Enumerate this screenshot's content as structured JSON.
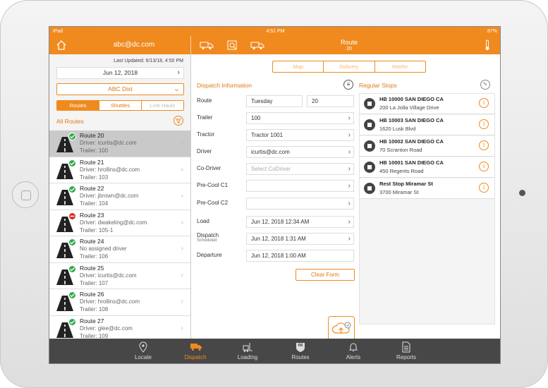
{
  "status": {
    "device": "iPad",
    "time": "4:51 PM",
    "battery": "87%"
  },
  "header": {
    "user_email": "abc@dc.com",
    "title": "Route",
    "route_number": "20"
  },
  "sidebar": {
    "last_updated": "Last Updated: 6/13/18, 4:50 PM",
    "date": "Jun 12, 2018",
    "distribution": "ABC Dist",
    "tabs": [
      "Routes",
      "Shuttles",
      "Line Hauls"
    ],
    "list_title": "All Routes",
    "routes": [
      {
        "name": "Route 20",
        "line1": "Driver: icurtis@dc.com",
        "line2": "Trailer: 100",
        "status": "ok"
      },
      {
        "name": "Route 21",
        "line1": "Driver: hrollins@dc.com",
        "line2": "Trailer: 103",
        "status": "ok"
      },
      {
        "name": "Route 22",
        "line1": "Driver: jbrown@dc.com",
        "line2": "Trailer: 104",
        "status": "ok"
      },
      {
        "name": "Route 23",
        "line1": "Driver: dwakeling@dc.com",
        "line2": "Trailer: 105-1",
        "status": "error"
      },
      {
        "name": "Route 24",
        "line1": "No assigned driver",
        "line2": "Trailer: 106",
        "status": "ok"
      },
      {
        "name": "Route 25",
        "line1": "Driver: icurtis@dc.com",
        "line2": "Trailer: 107",
        "status": "ok"
      },
      {
        "name": "Route 26",
        "line1": "Driver: hrollins@dc.com",
        "line2": "Trailer: 108",
        "status": "ok"
      },
      {
        "name": "Route 27",
        "line1": "Driver: glee@dc.com",
        "line2": "Trailer: 109",
        "status": "ok"
      }
    ]
  },
  "main": {
    "view_tabs": [
      "Map",
      "Delivery",
      "Reefer"
    ],
    "dispatch_title": "Dispatch Information",
    "stops_title": "Regular Stops",
    "fields": {
      "route_label": "Route",
      "route_day": "Tuesday",
      "route_number": "20",
      "trailer_label": "Trailer",
      "trailer": "100",
      "tractor_label": "Tractor",
      "tractor": "Tractor 1001",
      "driver_label": "Driver",
      "driver": "icurtis@dc.com",
      "codriver_label": "Co-Driver",
      "codriver_placeholder": "Select CoDriver",
      "precool1_label": "Pre-Cool C1",
      "precool1": "",
      "precool2_label": "Pre-Cool C2",
      "precool2": "",
      "load_label": "Load",
      "load": "Jun 12, 2018 12:34 AM",
      "dispatch_label": "Dispatch",
      "dispatch_sub": "Scheduled",
      "dispatch": "Jun 12, 2018 1:31 AM",
      "departure_label": "Departure",
      "departure": "Jun 12, 2018 1:00 AM"
    },
    "clear_form": "Clear Form",
    "stops": [
      {
        "name": "HB 10000 SAN DIEGO CA",
        "address": "200 La Jolla Village Drive"
      },
      {
        "name": "HB 10003 SAN DIEGO CA",
        "address": "1620 Lusk Blvd"
      },
      {
        "name": "HB 10002 SAN DIEGO CA",
        "address": "70 Scranton Road"
      },
      {
        "name": "HB 10001 SAN DIEGO CA",
        "address": "450 Regents Road"
      },
      {
        "name": "Rest Stop Miramar St",
        "address": "3700 Miramar St"
      }
    ]
  },
  "tabbar": {
    "items": [
      "Locate",
      "Dispatch",
      "Loading",
      "Routes",
      "Alerts",
      "Reports"
    ],
    "routes_badge": "66"
  },
  "colors": {
    "accent": "#f08a1e",
    "ok": "#2eab4e",
    "error": "#d9261c",
    "tabbar": "#474747"
  },
  "icons": [
    "home-icon",
    "truck-list-icon",
    "map-search-icon",
    "truck-icon",
    "thermometer-icon",
    "filter-icon",
    "menu-icon",
    "pencil-icon",
    "info-icon",
    "cloud-upload-icon"
  ]
}
